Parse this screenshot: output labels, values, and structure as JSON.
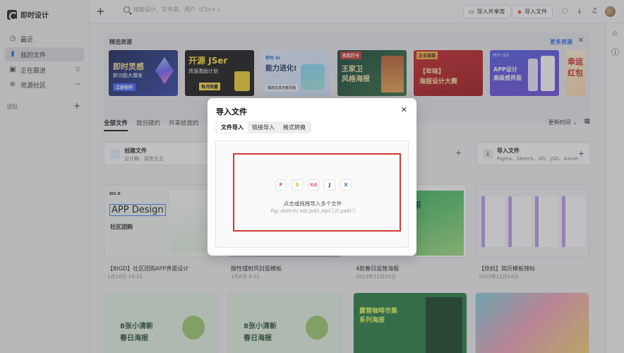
{
  "app": {
    "name": "即时设计"
  },
  "sidebar": {
    "items": [
      {
        "label": "最近",
        "icon": "clock-icon",
        "right": ""
      },
      {
        "label": "我的文件",
        "icon": "file-icon",
        "right": ""
      },
      {
        "label": "正在跟进",
        "icon": "follow-icon",
        "right": "0"
      },
      {
        "label": "资源社区",
        "icon": "globe-icon",
        "right": "→"
      }
    ],
    "team_label": "团队",
    "team_add": "+"
  },
  "topbar": {
    "search_placeholder": "搜索设计、文件夹、用户（Ctrl+.）",
    "import_library": "导入共享库",
    "import_file": "导入文件"
  },
  "featured": {
    "title": "精选资源",
    "more": "更多资源",
    "banners": [
      {
        "line1": "即时灵感",
        "line2": "新功能大爆发",
        "tag": "立即创作"
      },
      {
        "line1": "开源 JSer",
        "line2": "资源激励计划",
        "tag": "每月限量"
      },
      {
        "line1": "即时 AI",
        "line2": "能力进化!",
        "tag": "描述生成全套页面"
      },
      {
        "line1": "王家卫",
        "line2": "风格海报",
        "tag": "有奖打卡"
      },
      {
        "line1": "【年味】",
        "line2": "海报设计大赛",
        "tag": "企业真题"
      },
      {
        "line1": "APP设计",
        "line2": "高级感界面",
        "tag": "FEYT 设计"
      },
      {
        "line1": "幸运",
        "line2": "红包",
        "tag": ""
      }
    ]
  },
  "tabs": [
    "全部文件",
    "我创建的",
    "共享给我的",
    "回"
  ],
  "sort_label": "更新时间",
  "create": {
    "title": "创建文件",
    "subtitle": "设计稿、原型交互",
    "import_title": "导入文件",
    "import_subtitle": "Figma、Sketch、XD、JSD、Axure"
  },
  "files": [
    {
      "name": "【BIGD】社区团购APP界面设计",
      "date": "1月10日 19:22",
      "thumb_title": "APP Design",
      "thumb_sub": "社区团购"
    },
    {
      "name": "酸性镭射风封面模板",
      "date": "1月8日 9:51",
      "thumb_title": "",
      "thumb_sub": ""
    },
    {
      "name": "4款春日运营海报",
      "date": "2023年12月25日",
      "thumb_title": "春茶",
      "thumb_sub": ""
    },
    {
      "name": "【徐杭】简历模板锦标",
      "date": "2023年12月14日",
      "thumb_title": "",
      "thumb_sub": ""
    },
    {
      "name": "",
      "date": "",
      "thumb_title": "8张小清新",
      "thumb_sub": "春日海报"
    },
    {
      "name": "",
      "date": "",
      "thumb_title": "8张小清新",
      "thumb_sub": "春日海报"
    },
    {
      "name": "",
      "date": "",
      "thumb_title": "露营咖啡市集",
      "thumb_sub": "系列海报"
    },
    {
      "name": "",
      "date": "",
      "thumb_title": "",
      "thumb_sub": ""
    }
  ],
  "modal": {
    "title": "导入文件",
    "tabs": [
      "文件导入",
      "链接导入",
      "格式转换"
    ],
    "format_icons": [
      "F",
      "S",
      "Xd",
      "J",
      "X"
    ],
    "drop_text": "点击或拖拽导入多个文件",
    "drop_formats": ".fig/.sketch/.xd/.jsd/(.zip)ⓘ/(.psd)ⓘ"
  },
  "colors": {
    "accent": "#2f6bdf",
    "highlight": "#d23a3a"
  }
}
